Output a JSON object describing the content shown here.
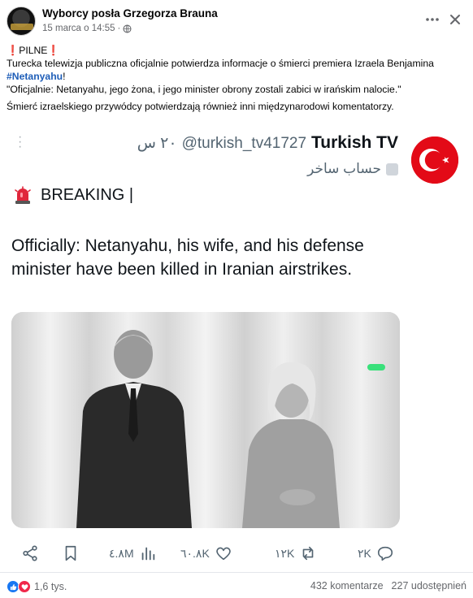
{
  "post": {
    "page_name": "Wyborcy posła Grzegorza Brauna",
    "timestamp": "15 marca o 14:55",
    "separator": "·",
    "more_icon": "ellipsis-icon",
    "close_icon": "close-icon",
    "privacy_icon": "globe-icon",
    "text": {
      "urgent_label": "PILNE",
      "line1": "Turecka telewizja publiczna oficjalnie potwierdza informacje o śmierci premiera Izraela Benjamina",
      "hashtag": "#Netanyahu",
      "hashtag_suffix": "!",
      "quote": "\"Oficjalnie: Netanyahu, jego żona, i jego minister obrony zostali zabici w irańskim nalocie.\"",
      "line3": "Śmierć izraelskiego przywódcy potwierdzają również inni międzynarodowi komentatorzy."
    }
  },
  "tweet": {
    "display_name": "Turkish TV",
    "handle": "@turkish_tv41727",
    "time_ago": "٢٠ س",
    "parody_label": "حساب ساخر",
    "breaking_label": "BREAKING |",
    "body": "Officially: Netanyahu, his wife, and his defense minister have been killed in Iranian airstrikes.",
    "actions": {
      "replies": "٢K",
      "reposts": "١٢K",
      "likes": "٦٠.٨K",
      "views": "٤.٨M"
    }
  },
  "footer": {
    "reaction_count": "1,6 tys.",
    "comments": "432 komentarze",
    "shares": "227 udostępnień"
  },
  "colors": {
    "hashtag": "#1f5eb8",
    "flag_red": "#e30a17",
    "like_blue": "#1877f2",
    "love_red": "#f0284a"
  }
}
